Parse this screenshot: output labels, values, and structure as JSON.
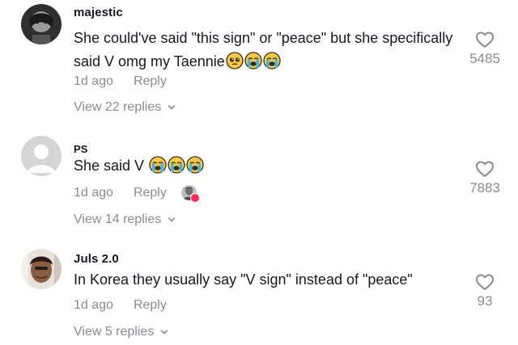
{
  "comments": [
    {
      "username": "majestic",
      "text": "She could've said \"this sign\" or \"peace\" but she specifically said V omg my Taennie",
      "emojis": [
        "pleading-face-icon",
        "loudly-crying-face-icon",
        "loudly-crying-face-icon"
      ],
      "time": "1d ago",
      "reply_label": "Reply",
      "view_replies": "View 22 replies",
      "likes": "5485",
      "avatar": "dark-avatar"
    },
    {
      "username": "PS",
      "text": "She said V",
      "emojis": [
        "loudly-crying-face-icon",
        "loudly-crying-face-icon",
        "loudly-crying-face-icon"
      ],
      "time": "1d ago",
      "reply_label": "Reply",
      "view_replies": "View 14 replies",
      "likes": "7883",
      "avatar": "default-avatar",
      "creator_liked": true
    },
    {
      "username": "Juls 2.0",
      "text": "In Korea they usually say \"V sign\" instead of \"peace\"",
      "emojis": [],
      "time": "1d ago",
      "reply_label": "Reply",
      "view_replies": "View 5 replies",
      "likes": "93",
      "avatar": "photo-avatar"
    }
  ],
  "colors": {
    "text": "#161823",
    "secondary": "#8a8b91",
    "accent": "#fe2c55"
  }
}
